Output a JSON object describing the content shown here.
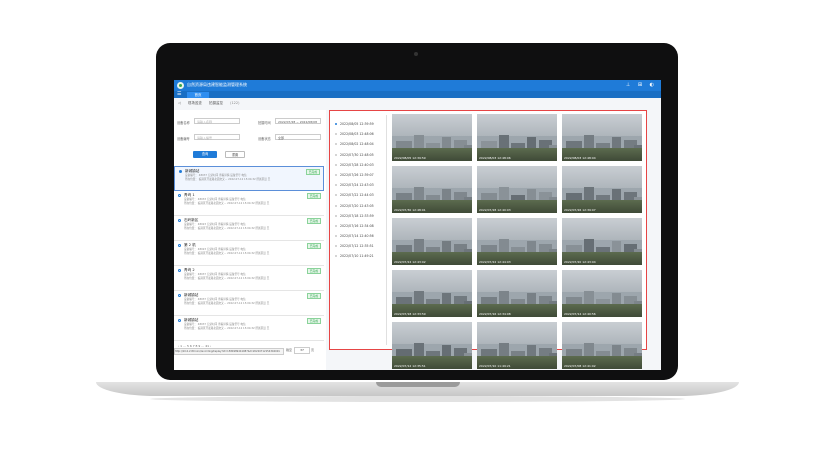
{
  "app": {
    "title": "自然资源局违建智能监测管理系统",
    "header_icons": "⊥ ⊞ ◐",
    "menu_icon": "☰",
    "nav_tab": "首页"
  },
  "breadcrumb": {
    "back": "◁",
    "level1": "现场巡查",
    "level2": "拍摄监控",
    "count": "(122)"
  },
  "filters": {
    "device_name_label": "设备名称",
    "device_name_placeholder": "请输入名称",
    "shoot_time_label": "拍摄时间",
    "shoot_time_value": "2022/07/28  ~  2022/08/08",
    "device_id_label": "设备编号",
    "device_id_placeholder": "请输入编号",
    "status_label": "设备状态",
    "status_value": "全部",
    "query_button": "查询",
    "reset_button": "重置"
  },
  "cards": [
    {
      "name": "新城镇站",
      "line1": "设备编号：  48037       记录时间   查看详情            设备型号   电信",
      "line2": "所在位置：  临港区开发路北面交叉…    2022-07-12 15:04:32      所属区县   丑",
      "status": "已完成",
      "selected": true
    },
    {
      "name": "青坞 1",
      "line1": "设备编号：  48033       记录时间   查看详情            设备型号   电信",
      "line2": "所在位置：  临港区开发路北面交叉…    2022-07-12 15:04:32      所属区县   丑",
      "status": "已完成",
      "selected": false
    },
    {
      "name": "石岭新区",
      "line1": "设备编号：  48023       记录时间   查看详情            设备型号   电信",
      "line2": "所在位置：  临港区开发路北面交叉…    2022-07-12 15:04:32      所属区县   丑",
      "status": "已完成",
      "selected": false
    },
    {
      "name": "第 2 机",
      "line1": "设备编号：  48023       记录时间   查看详情            设备型号   电信",
      "line2": "所在位置：  临港区开发路北面交叉…    2022-07-12 15:04:32      所属区县   丑",
      "status": "已完成",
      "selected": false
    },
    {
      "name": "青坞 2",
      "line1": "设备编号：  48037       记录时间   查看详情            设备型号   电信",
      "line2": "所在位置：  临港区开发路北面交叉…    2022-07-12 15:04:32      所属区县   丑",
      "status": "已完成",
      "selected": false
    },
    {
      "name": "新城镇站",
      "line1": "设备编号：  48037       记录时间   查看详情            设备型号   电信",
      "line2": "所在位置：  临港区开发路北面交叉…    2022-07-12 15:04:32      所属区县   丑",
      "status": "已完成",
      "selected": false
    },
    {
      "name": "新城镇站",
      "line1": "设备编号：  48037       记录时间   查看详情            设备型号   电信",
      "line2": "所在位置：  临港区开发路北面交叉…    2022-07-12 15:04:32      所属区县   丑",
      "status": "已完成",
      "selected": false
    }
  ],
  "pager": {
    "pages": "‹   1   …   5   6   7   8   9   …   41   ›",
    "url_tip": "http://10.0.2.80:xxx/recordingdisplay?id=1584989441987&t=20220712154304001",
    "jump_label": "跳至",
    "jump_value": "37",
    "jump_suffix": "页"
  },
  "timeline": [
    "2022/08/05 12:39:59",
    "2022/08/03 12:48:06",
    "2022/08/02 12:48:04",
    "2022/07/30 12:48:05",
    "2022/07/28 12:40:03",
    "2022/07/26 12:39:07",
    "2022/07/24 12:43:03",
    "2022/07/22 12:44:03",
    "2022/07/20 12:43:05",
    "2022/07/18 12:33:59",
    "2022/07/16 12:34:08",
    "2022/07/14 12:40:56",
    "2022/07/12 12:35:51",
    "2022/07/10 11:49:21"
  ],
  "thumbnails": [
    "2022/08/05 12:39:59",
    "2022/08/03 12:48:06",
    "2022/08/03 12:48:04",
    "2022/07/30 12:48:01",
    "2022/07/28 12:40:03",
    "2022/07/26 12:39:07",
    "2022/07/24 12:43:02",
    "2022/07/22 12:44:03",
    "2022/07/20 12:43:04",
    "2022/07/18 12:33:59",
    "2022/07/16 12:34:08",
    "2022/07/14 12:40:56",
    "2022/07/12 12:35:51",
    "2022/07/10 11:49:21",
    "2022/07/08 12:41:02"
  ]
}
